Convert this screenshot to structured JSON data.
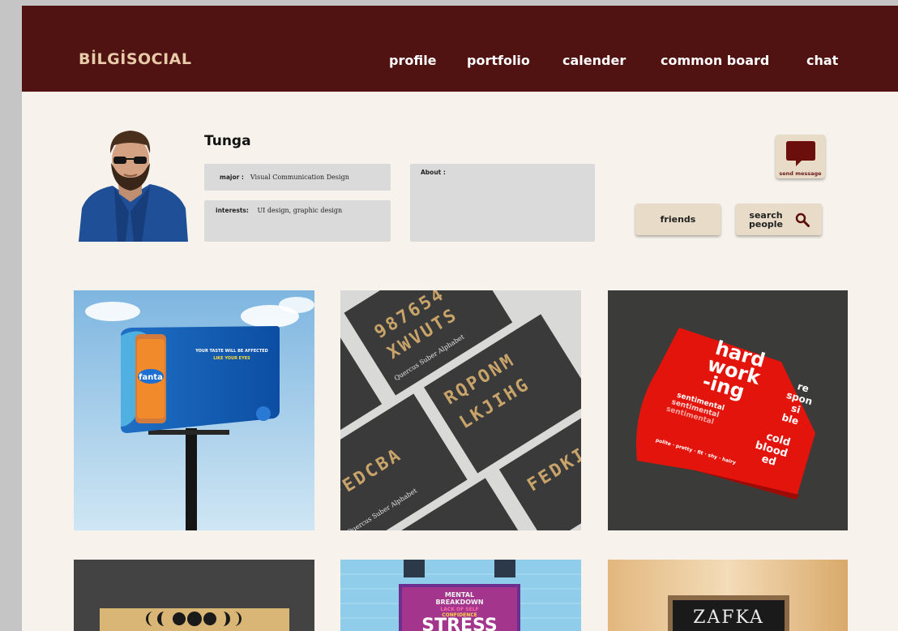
{
  "header": {
    "brand": "BİLGİSOCIAL",
    "nav": [
      "profile",
      "portfolio",
      "calender",
      "common board",
      "chat"
    ]
  },
  "profile": {
    "name": "Tunga",
    "major_label": "major :",
    "major": "Visual Communication Design",
    "interests_label": "interests:",
    "interests": "UI design, graphic design",
    "about_label": "About :",
    "about": ""
  },
  "actions": {
    "send_message": "send message",
    "friends": "friends",
    "search_people": "search people"
  },
  "portfolio": {
    "billboard": {
      "headline_line1": "YOUR TASTE WILL BE AFFECTED",
      "headline_line2": "LIKE YOUR EYES",
      "brand": "fanta"
    },
    "alphabet": {
      "caption": "Quercus Suber Alphabet",
      "glyphs_line1": "987654",
      "glyphs_line2": "XWVUTS",
      "glyphs_line3": "RQPONM",
      "glyphs_line4": "LKJIHG",
      "glyphs_line5": "FEDCBA",
      "glyphs_line6": "FEDKI"
    },
    "poster": {
      "line1": "hard",
      "line2": "work",
      "line3": "-ing",
      "side1": "re",
      "side2": "spon",
      "side3": "si",
      "side4": "ble",
      "sentimental": "sentimental",
      "cold1": "cold",
      "cold2": "blood",
      "cold3": "ed",
      "curve": "polite · pretty · fit · shy · hairy"
    },
    "stress": {
      "line1": "MENTAL",
      "line2": "BREAKDOWN",
      "line3": "LACK OF SELF",
      "line4": "CONFIDENCE",
      "line5": "STRESS"
    },
    "sign": {
      "text": "ZAFKA"
    }
  },
  "colors": {
    "header_bg": "#511312",
    "brand_text": "#e8cba8",
    "page_bg": "#f7f3ec",
    "button_bg": "#e8dbc7",
    "accent_red": "#e3140c"
  },
  "icons": {
    "send_message": "chat-bubble-icon",
    "search": "magnifier-icon"
  }
}
